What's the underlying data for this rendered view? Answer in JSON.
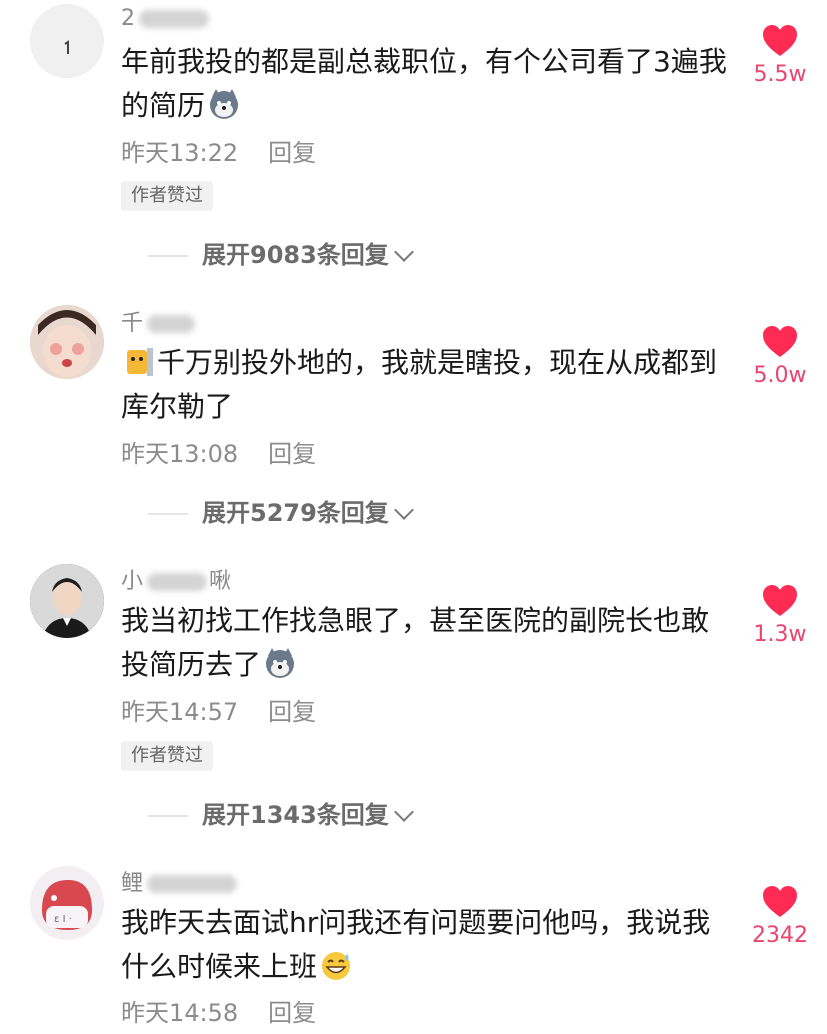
{
  "comments": [
    {
      "username": "2",
      "text": "年前我投的都是副总裁职位，有个公司看了3遍我的简历",
      "emoji": "wolf-emoji",
      "time": "昨天13:22",
      "reply": "回复",
      "author_liked": "作者赞过",
      "expand": "展开9083条回复",
      "likes": "5.5w"
    },
    {
      "username": "千",
      "emoji_prefix": "cat-box-emoji",
      "text": "千万别投外地的，我就是瞎投，现在从成都到库尔勒了",
      "time": "昨天13:08",
      "reply": "回复",
      "expand": "展开5279条回复",
      "likes": "5.0w"
    },
    {
      "username": "小",
      "username_tail": "啾",
      "text": "我当初找工作找急眼了，甚至医院的副院长也敢投简历去了",
      "emoji": "wolf-emoji",
      "time": "昨天14:57",
      "reply": "回复",
      "author_liked": "作者赞过",
      "expand": "展开1343条回复",
      "likes": "1.3w"
    },
    {
      "username": "鲤",
      "text": "我昨天去面试hr问我还有问题要问他吗，我说我什么时候来上班",
      "emoji": "grin-sweat-emoji",
      "time": "昨天14:58",
      "reply": "回复",
      "likes": "2342"
    }
  ],
  "colors": {
    "heart": "#fe2c55",
    "likes_text": "#e8456f",
    "meta": "#8c8c8c"
  }
}
